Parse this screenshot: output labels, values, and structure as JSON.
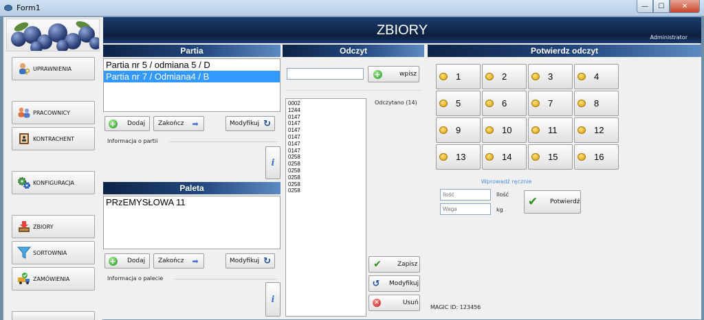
{
  "window": {
    "title": "Form1",
    "min": "—",
    "max": "☐",
    "close": "✕"
  },
  "header": {
    "title": "ZBIORY",
    "user": "Administrator"
  },
  "sidebar": {
    "items": [
      {
        "label": "UPRAWNIENIA",
        "icon": "user-key-icon"
      },
      {
        "label": "PRACOWNICY",
        "icon": "people-icon"
      },
      {
        "label": "KONTRACHENT",
        "icon": "contact-book-icon"
      },
      {
        "label": "KONFIGURACJA",
        "icon": "gears-icon"
      },
      {
        "label": "ZBIORY",
        "icon": "inbox-download-icon"
      },
      {
        "label": "SORTOWNIA",
        "icon": "funnel-icon"
      },
      {
        "label": "ZAMÓWIENIA",
        "icon": "truck-check-icon"
      }
    ]
  },
  "partia": {
    "title": "Partia",
    "items": [
      "Partia nr 5 / odmiana 5 / D",
      "Partia nr 7 / Odmiana4 / B"
    ],
    "selected_index": 1,
    "add_label": "Dodaj",
    "finish_label": "Zakończ",
    "modify_label": "Modyfikuj",
    "info_label": "Informacja o partii",
    "info_icon": "i"
  },
  "paleta": {
    "title": "Paleta",
    "items": [
      "PRzEMYSŁOWA 11"
    ],
    "add_label": "Dodaj",
    "finish_label": "Zakończ",
    "modify_label": "Modyfikuj",
    "info_label": "Informacja o palecie",
    "info_icon": "i"
  },
  "odczyt": {
    "title": "Odczyt",
    "input_value": "",
    "wpisz_label": "wpisz",
    "count_label": "Odczytano (14)",
    "readings": [
      "0002",
      "1244",
      "0147",
      "0147",
      "0147",
      "0147",
      "0147",
      "0147",
      "0258",
      "0258",
      "0258",
      "0258",
      "0258",
      "0258"
    ],
    "save_label": "Zapisz",
    "modify_label": "Modyfikuj",
    "delete_label": "Usuń"
  },
  "potwierdz": {
    "title": "Potwierdz odczyt",
    "numbers": [
      "1",
      "2",
      "3",
      "4",
      "5",
      "6",
      "7",
      "8",
      "9",
      "10",
      "11",
      "12",
      "13",
      "14",
      "15",
      "16"
    ],
    "manual_label": "Wprowadź ręcznie",
    "qty_placeholder": "Ilość",
    "qty_unit": "Ilość",
    "weight_placeholder": "Waga",
    "weight_unit": "kg",
    "confirm_label": "Potwierdź",
    "magic_id": "MAGIC ID: 123456"
  },
  "colors": {
    "header_bg": "#0c1f3f",
    "panel_head": "#22477d",
    "selection": "#3399ff",
    "manual_link": "#4a8fdc"
  }
}
